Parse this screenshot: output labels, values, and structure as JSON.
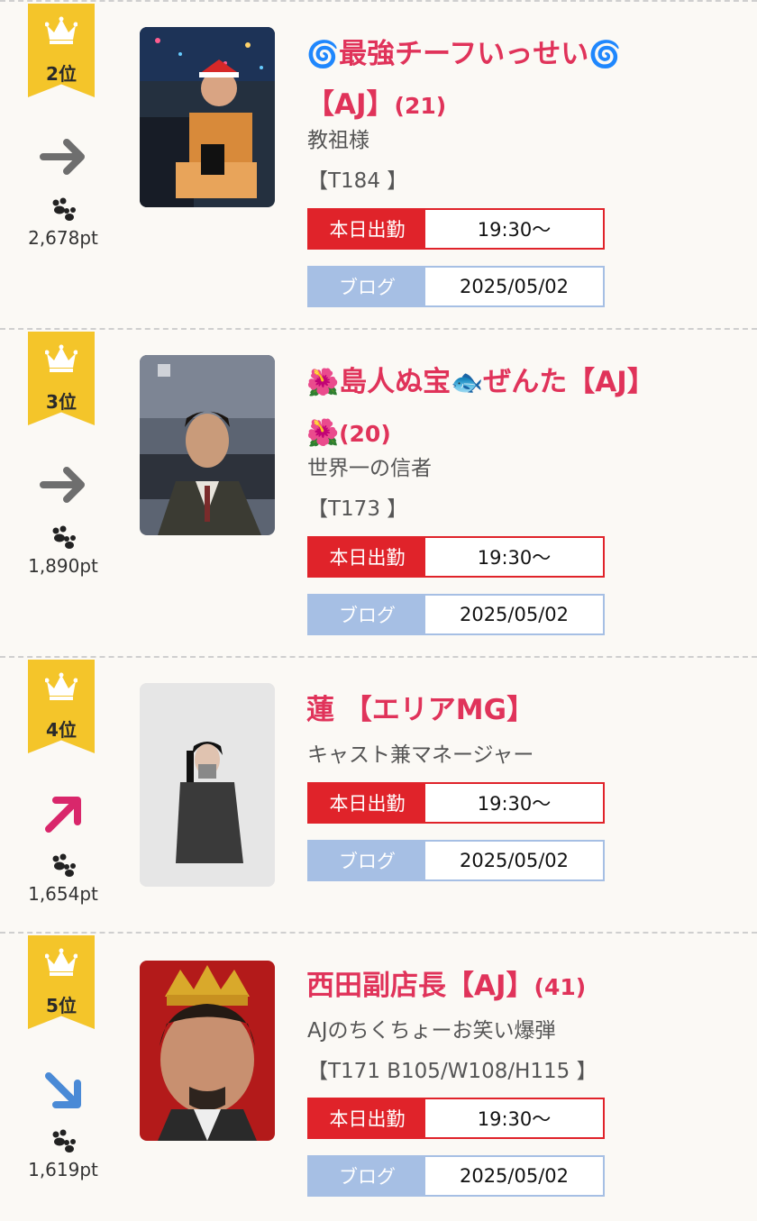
{
  "entries": [
    {
      "rank": "2位",
      "trend": "right-arrow-icon",
      "points": "2,678pt",
      "name_pre": "🌀",
      "name": "最強チーフいっせい",
      "name_post": "🌀",
      "name_line2": "【AJ】",
      "age": "(21)",
      "title": "教祖様",
      "spec": "【T184 】",
      "attendance_label": "本日出勤",
      "attendance_time": "19:30〜",
      "blog_label": "ブログ",
      "blog_date": "2025/05/02"
    },
    {
      "rank": "3位",
      "trend": "right-arrow-icon",
      "points": "1,890pt",
      "name_pre": "🌺",
      "name": "島人ぬ宝",
      "name_mid": "🐟",
      "name_post_text": "ぜんた【AJ】",
      "name_line2_emoji": "🌺",
      "age": "(20)",
      "title": "世界一の信者",
      "spec": "【T173 】",
      "attendance_label": "本日出勤",
      "attendance_time": "19:30〜",
      "blog_label": "ブログ",
      "blog_date": "2025/05/02"
    },
    {
      "rank": "4位",
      "trend": "up-right-arrow-icon",
      "points": "1,654pt",
      "name": "蓮 【エリアMG】",
      "title": "キャスト兼マネージャー",
      "attendance_label": "本日出勤",
      "attendance_time": "19:30〜",
      "blog_label": "ブログ",
      "blog_date": "2025/05/02"
    },
    {
      "rank": "5位",
      "trend": "down-right-arrow-icon",
      "points": "1,619pt",
      "name": "西田副店長【AJ】",
      "age": "(41)",
      "title": "AJのちくちょーお笑い爆弾",
      "spec": "【T171 B105/W108/H115 】",
      "attendance_label": "本日出勤",
      "attendance_time": "19:30〜",
      "blog_label": "ブログ",
      "blog_date": "2025/05/02"
    }
  ],
  "colors": {
    "badge": "#f4c52a",
    "name": "#e0335a",
    "attendance": "#e0232a",
    "blog": "#a6bfe4",
    "trend_same": "#6e6e6e",
    "trend_up": "#d9276b",
    "trend_down": "#4a8ad6"
  }
}
